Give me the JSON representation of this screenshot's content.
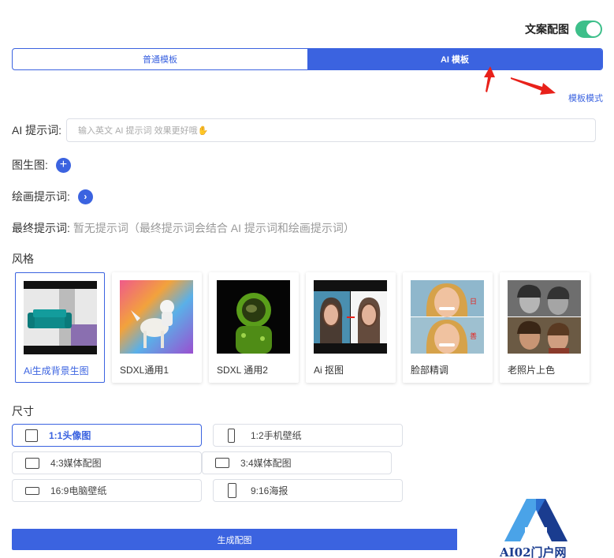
{
  "header": {
    "toggle_label": "文案配图",
    "toggle_on": true,
    "toggle_color": "#3dbf8a"
  },
  "tabs": [
    {
      "label": "普通模板",
      "active": false
    },
    {
      "label": "AI 模板",
      "active": true
    }
  ],
  "mode_link": "模板模式",
  "ai_prompt": {
    "label": "AI 提示词:",
    "placeholder": "输入英文 AI 提示词 效果更好哦✋"
  },
  "img2img": {
    "label": "图生图:",
    "icon": "plus-icon"
  },
  "paint_prompt": {
    "label": "绘画提示词:",
    "icon": "chevron-right-icon"
  },
  "final_prompt": {
    "label": "最终提示词:",
    "value": "暂无提示词（最终提示词会结合 AI 提示词和绘画提示词）"
  },
  "style_section": {
    "title": "风格",
    "items": [
      {
        "label": "Ai生成背景生图",
        "selected": true
      },
      {
        "label": "SDXL通用1",
        "selected": false
      },
      {
        "label": "SDXL 通用2",
        "selected": false
      },
      {
        "label": "Ai 抠图",
        "selected": false
      },
      {
        "label": "脸部精调",
        "selected": false
      },
      {
        "label": "老照片上色",
        "selected": false
      }
    ]
  },
  "size_section": {
    "title": "尺寸",
    "items": [
      {
        "label": "1:1头像图",
        "selected": true
      },
      {
        "label": "1:2手机壁纸",
        "selected": false
      },
      {
        "label": "4:3媒体配图",
        "selected": false
      },
      {
        "label": "3:4媒体配图",
        "selected": false
      },
      {
        "label": "16:9电脑壁纸",
        "selected": false
      },
      {
        "label": "9:16海报",
        "selected": false
      }
    ]
  },
  "generate_button": "生成配图",
  "watermark": "AI02门户网",
  "accent_color": "#3b63e0"
}
